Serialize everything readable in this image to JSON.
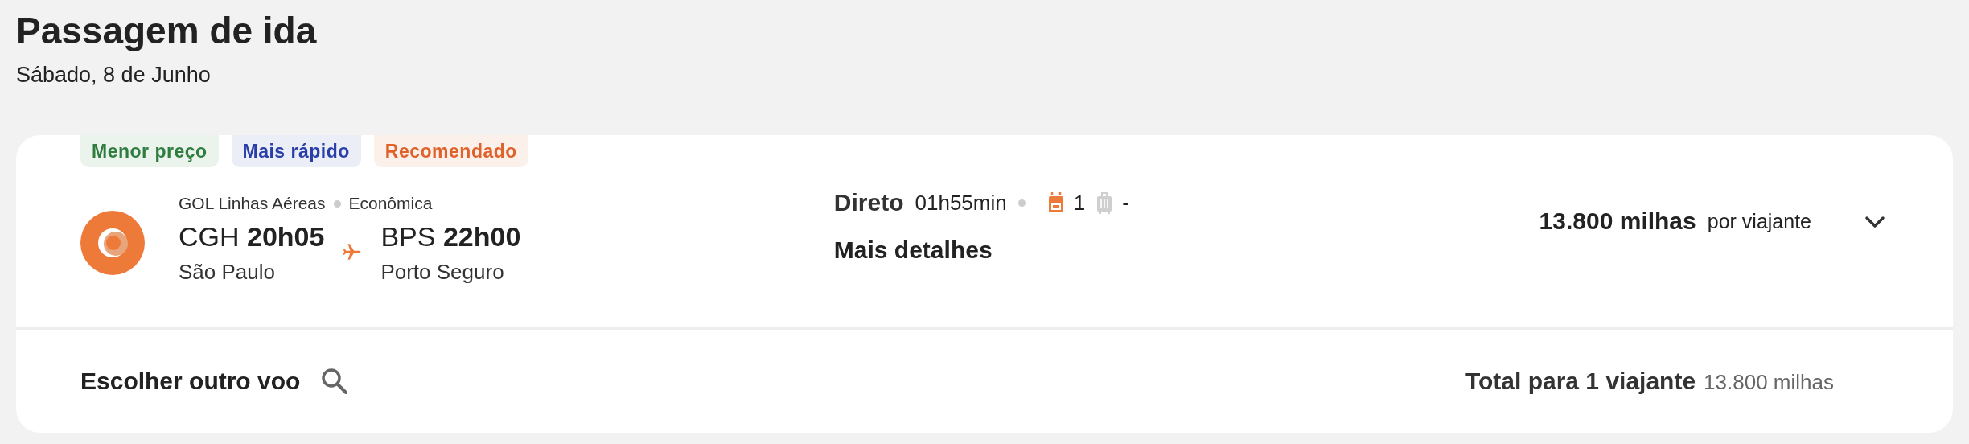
{
  "header": {
    "title": "Passagem de ida",
    "date": "Sábado, 8 de Junho"
  },
  "flight": {
    "tags": [
      {
        "label": "Menor preço",
        "color": "#2e7d3f"
      },
      {
        "label": "Mais rápido",
        "color": "#2a3ea8"
      },
      {
        "label": "Recomendado",
        "color": "#e0612a"
      }
    ],
    "airline": "GOL Linhas Aéreas",
    "cabin": "Econômica",
    "departure": {
      "code": "CGH",
      "time": "20h05",
      "city": "São Paulo"
    },
    "arrival": {
      "code": "BPS",
      "time": "22h00",
      "city": "Porto Seguro"
    },
    "stops": "Direto",
    "duration": "01h55min",
    "baggage": [
      {
        "kind": "backpack",
        "included": true,
        "count": "1"
      },
      {
        "kind": "suitcase",
        "included": false,
        "count": "-"
      }
    ],
    "details_link": "Mais detalhes",
    "price": "13.800 milhas",
    "price_note": "por viajante",
    "expanded": false
  },
  "footer": {
    "change_flight": "Escolher outro voo",
    "total_label": "Total para 1 viajante",
    "total_value": "13.800 milhas"
  }
}
